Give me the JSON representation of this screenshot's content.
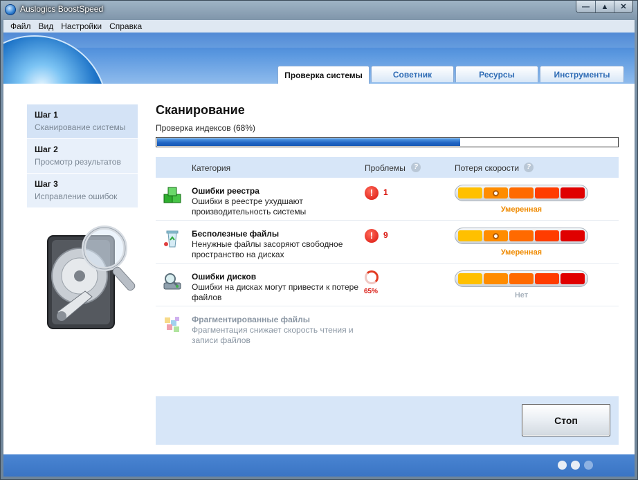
{
  "window": {
    "title": "Auslogics BoostSpeed",
    "controls": {
      "minimize": "—",
      "maximize": "▲",
      "close": "✕"
    }
  },
  "menu": [
    "Файл",
    "Вид",
    "Настройки",
    "Справка"
  ],
  "tabs": [
    {
      "label": "Проверка системы",
      "active": true
    },
    {
      "label": "Советник",
      "active": false
    },
    {
      "label": "Ресурсы",
      "active": false
    },
    {
      "label": "Инструменты",
      "active": false
    }
  ],
  "steps": [
    {
      "title": "Шаг 1",
      "subtitle": "Сканирование системы",
      "active": true
    },
    {
      "title": "Шаг 2",
      "subtitle": "Просмотр результатов",
      "active": false
    },
    {
      "title": "Шаг 3",
      "subtitle": "Исправление ошибок",
      "active": false
    }
  ],
  "scan": {
    "title": "Сканирование",
    "status": "Проверка индексов (68%)",
    "progress": 0.66
  },
  "columns": {
    "category": "Категория",
    "problems": "Проблемы",
    "speed_loss": "Потеря скорости",
    "help": "?"
  },
  "rows": [
    {
      "title": "Ошибки реестра",
      "description": "Ошибки в реестре ухудшают производительность системы",
      "badge": "!",
      "problems": "1",
      "speed_level": 2,
      "speed_label": "Умеренная",
      "icon": "registry-cubes-icon"
    },
    {
      "title": "Бесполезные файлы",
      "description": "Ненужные файлы засоряют свободное пространство на дисках",
      "badge": "!",
      "problems": "9",
      "speed_level": 2,
      "speed_label": "Умеренная",
      "icon": "recycle-bin-icon"
    },
    {
      "title": "Ошибки дисков",
      "description": "Ошибки на дисках могут привести к потере файлов",
      "progress_text": "65%",
      "speed_level": 0,
      "speed_label": "Нет",
      "icon": "disk-magnifier-icon"
    },
    {
      "title": "Фрагментированные файлы",
      "description": "Фрагментация снижает скорость чтения и записи файлов",
      "icon": "fragmentation-blocks-icon"
    }
  ],
  "meter_colors": [
    "#ffc000",
    "#ff8c00",
    "#ff6a00",
    "#ff3c00",
    "#e00000"
  ],
  "stop_button": "Стоп",
  "pager": {
    "total": 3,
    "active": [
      0,
      1
    ]
  }
}
